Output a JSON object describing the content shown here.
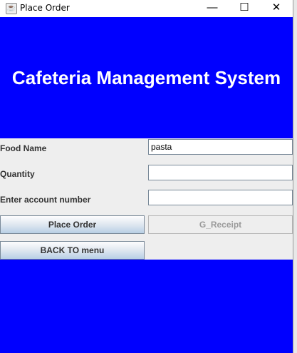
{
  "window": {
    "title": "Place Order",
    "controls": {
      "minimize": "—",
      "maximize": "☐",
      "close": "✕"
    }
  },
  "header": {
    "title": "Cafeteria Management System",
    "background": "#0000ff"
  },
  "form": {
    "food_name_label": "Food Name",
    "food_name_value": "pasta",
    "quantity_label": "Quantity",
    "quantity_value": "",
    "account_label": "Enter account number",
    "account_value": ""
  },
  "buttons": {
    "place_order": "Place Order",
    "receipt": "G_Receipt",
    "back": "BACK TO menu"
  }
}
